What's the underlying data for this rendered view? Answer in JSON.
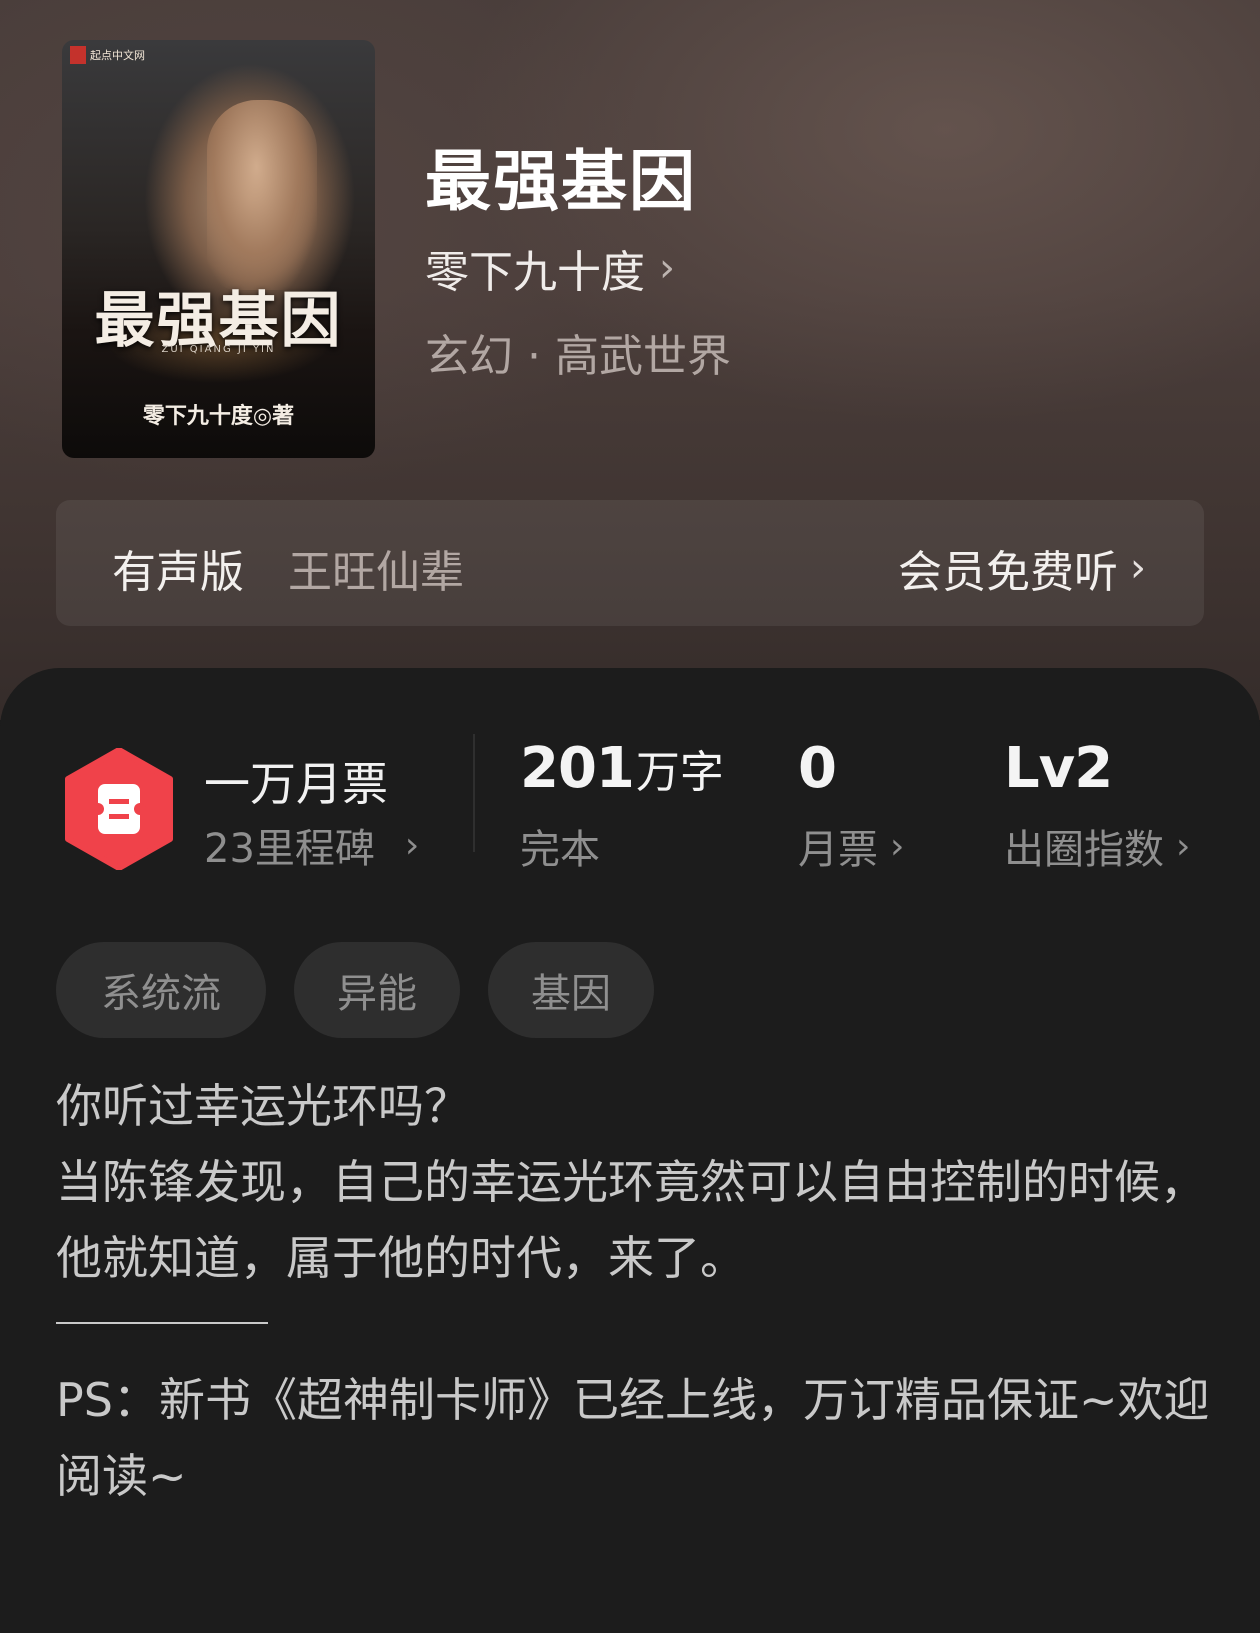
{
  "book": {
    "title": "最强基因",
    "author": "零下九十度",
    "genre": "玄幻 · 高武世界",
    "cover": {
      "publisher": "起点中文网",
      "title": "最强基因",
      "pinyin": "ZUI QIANG JI YIN",
      "author_credit": "零下九十度◎著"
    }
  },
  "audio": {
    "label": "有声版",
    "narrator": "王旺仙辈",
    "action": "会员免费听"
  },
  "stats": {
    "tickets": {
      "title": "一万月票",
      "sub": "23里程碑"
    },
    "words": {
      "value": "201",
      "unit": "万字",
      "label": "完本"
    },
    "monthly": {
      "value": "0",
      "label": "月票"
    },
    "influence": {
      "value": "Lv2",
      "label": "出圈指数"
    }
  },
  "tags": [
    "系统流",
    "异能",
    "基因"
  ],
  "description": {
    "lines": [
      "你听过幸运光环吗？",
      "当陈锋发现，自己的幸运光环竟然可以自由控制的时候，他就知道，属于他的时代，来了。"
    ],
    "ps": "PS：新书《超神制卡师》已经上线，万订精品保证~欢迎阅读~"
  },
  "colors": {
    "accent_red": "#f0424a",
    "panel_bg": "#1c1c1c",
    "tag_bg": "#2e2e2e"
  },
  "icons": {
    "ticket": "ticket-icon",
    "chevron": "chevron-right-icon"
  }
}
